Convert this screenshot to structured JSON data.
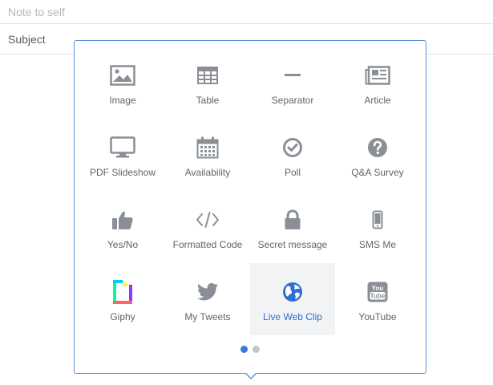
{
  "compose": {
    "to_placeholder": "Note to self",
    "subject_placeholder": "Subject"
  },
  "menu": {
    "items": [
      {
        "label": "Image",
        "icon": "image-icon"
      },
      {
        "label": "Table",
        "icon": "table-icon"
      },
      {
        "label": "Separator",
        "icon": "separator-icon"
      },
      {
        "label": "Article",
        "icon": "article-icon"
      },
      {
        "label": "PDF Slideshow",
        "icon": "monitor-icon"
      },
      {
        "label": "Availability",
        "icon": "calendar-icon"
      },
      {
        "label": "Poll",
        "icon": "check-circle-icon"
      },
      {
        "label": "Q&A Survey",
        "icon": "question-circle-icon"
      },
      {
        "label": "Yes/No",
        "icon": "thumbs-up-icon"
      },
      {
        "label": "Formatted Code",
        "icon": "code-icon"
      },
      {
        "label": "Secret message",
        "icon": "lock-icon"
      },
      {
        "label": "SMS Me",
        "icon": "phone-icon"
      },
      {
        "label": "Giphy",
        "icon": "giphy-icon"
      },
      {
        "label": "My Tweets",
        "icon": "twitter-bird-icon"
      },
      {
        "label": "Live Web Clip",
        "icon": "globe-icon",
        "selected": true
      },
      {
        "label": "YouTube",
        "icon": "youtube-icon"
      }
    ],
    "pagination": {
      "pages": 2,
      "current": 1
    }
  },
  "colors": {
    "accent": "#3c78d8",
    "popover_border": "#5c8fd6",
    "icon_gray": "#8a8f96",
    "label_gray": "#5f646b",
    "selected_bg": "#f2f3f5"
  }
}
